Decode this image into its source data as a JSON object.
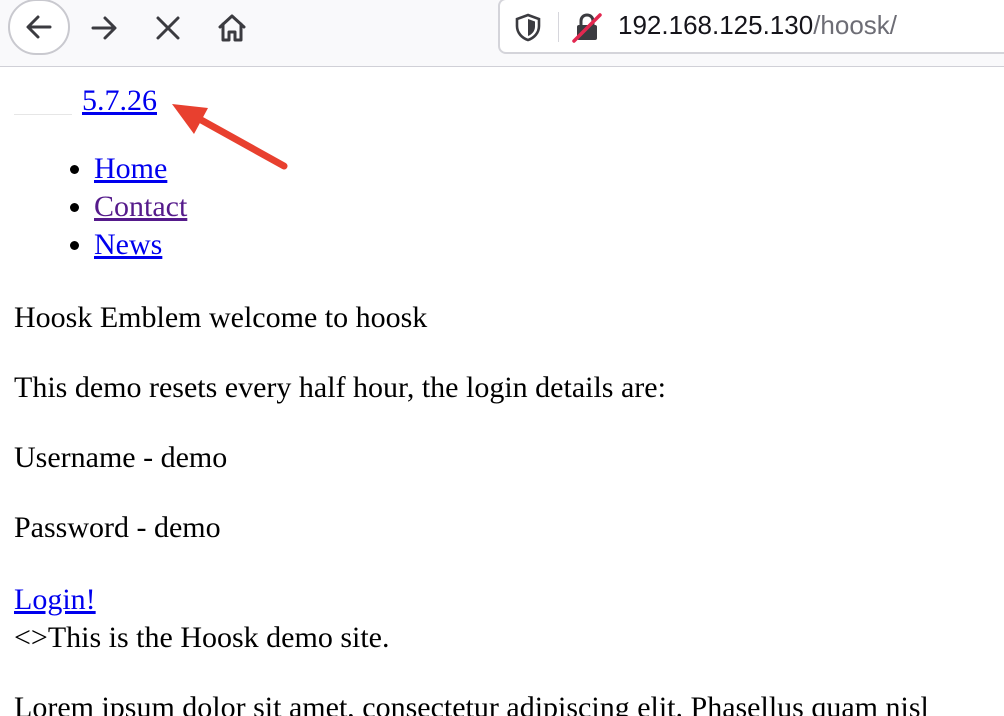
{
  "browser": {
    "url_host": "192.168.125.130",
    "url_path": "/hoosk/"
  },
  "page": {
    "version_link": "5.7.26",
    "nav": [
      "Home",
      "Contact",
      "News"
    ],
    "intro": "Hoosk Emblem welcome to hoosk",
    "demo_note": "This demo resets every half hour, the login details are:",
    "username": "Username - demo",
    "password": "Password - demo",
    "login_link": "Login!",
    "demo_site": "<>This is the Hoosk demo site.",
    "lorem": "Lorem ipsum dolor sit amet, consectetur adipiscing elit. Phasellus quam nisl"
  },
  "colors": {
    "link": "#0000ee",
    "visited_link": "#551a8b",
    "annotation_arrow": "#e8402f"
  }
}
